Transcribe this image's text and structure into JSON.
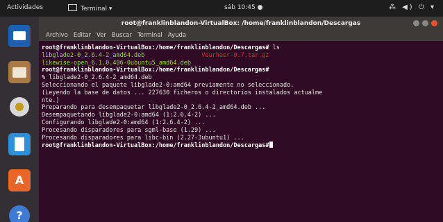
{
  "topbar": {
    "activities": "Actividades",
    "app_menu": "Terminal ▾",
    "clock": "sáb 10:45 ●",
    "tray": "⁂ ◀) ⏻ ▾"
  },
  "dock": {
    "items": [
      "mail",
      "files",
      "disc",
      "document",
      "software",
      "help"
    ],
    "help_glyph": "?"
  },
  "window": {
    "title": "root@franklinblandon-VirtualBox: /home/franklinblandon/Descargas",
    "menu": [
      "Archivo",
      "Editar",
      "Ver",
      "Buscar",
      "Terminal",
      "Ayuda"
    ]
  },
  "terminal": {
    "line1_prompt": "root@franklinblandon-VirtualBox:/home/franklinblandon/Descargas#",
    "line1_cmd": " ls",
    "file_deb1": "libglade2-0_2.6.4-2_amd64.deb",
    "file_tgz": "Vourheer-0.7.tar.gz",
    "file_deb2": "likewise-open_6.1.0.406-0ubuntu5_amd64.deb",
    "line4_prompt": "root@franklinblandon-VirtualBox:/home/franklinblandon/Descargas#",
    "line5": "% libglade2-0_2.6.4-2_amd64.deb",
    "line6": "Seleccionando el paquete libglade2-0:amd64 previamente no seleccionado.",
    "line7": "(Leyendo la base de datos ... 227630 ficheros o directorios instalados actualme",
    "line8": "nte.)",
    "line9": "Preparando para desempaquetar libglade2-0_2.6.4-2_amd64.deb ...",
    "line10": "Desempaquetando libglade2-0:amd64 (1:2.6.4-2) ...",
    "line11": "Configurando libglade2-0:amd64 (1:2.6.4-2) ...",
    "line12": "Procesando disparadores para sgml-base (1.29) ...",
    "line13": "Procesando disparadores para libc-bin (2.27-3ubuntu1) ...",
    "line14_prompt": "root@franklinblandon-VirtualBox:/home/franklinblandon/Descargas#"
  },
  "colors": {
    "terminal_bg": "#300a24",
    "deb_file": "#9fd34d",
    "archive_file": "#e02a2a",
    "accent": "#e95420"
  }
}
